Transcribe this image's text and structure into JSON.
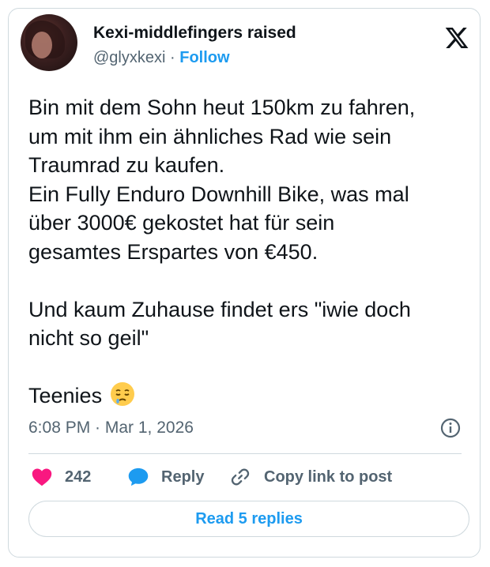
{
  "author": {
    "name": "Kexi-middlefingers raised",
    "handle": "@glyxkexi",
    "separator": "·",
    "follow_label": "Follow"
  },
  "tweet": {
    "text": "Bin mit dem Sohn heut 150km zu fahren,\num mit ihm ein ähnliches Rad wie sein\nTraumrad zu kaufen.\nEin Fully Enduro Downhill Bike, was mal\nüber 3000€ gekostet hat für sein\ngesamtes Erspartes von €450.\n\nUnd kaum Zuhause findet ers \"iwie doch\nnicht so geil\"\n\nTeenies",
    "emoji": "sleepy-face",
    "timestamp": "6:08 PM · Mar 1, 2026"
  },
  "actions": {
    "like_count": "242",
    "reply_label": "Reply",
    "copy_link_label": "Copy link to post"
  },
  "footer": {
    "read_replies_label": "Read 5 replies"
  },
  "colors": {
    "accent": "#1d9bf0",
    "like": "#f91880",
    "muted": "#536471",
    "border": "#cfd9de"
  }
}
